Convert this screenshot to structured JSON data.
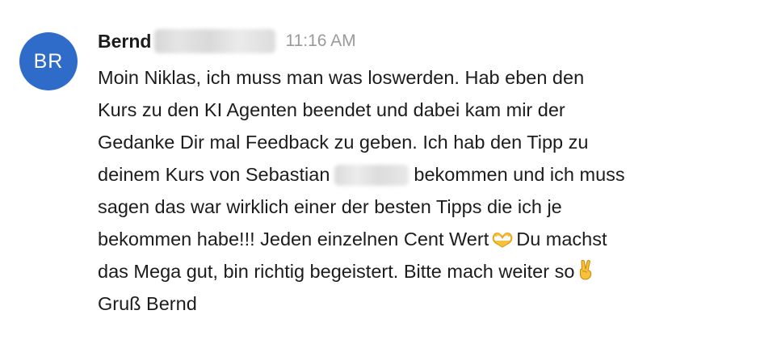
{
  "message": {
    "avatar_initials": "BR",
    "avatar_color": "#2f6bc9",
    "sender_first_name": "Bernd",
    "sender_last_name_redacted": true,
    "timestamp": "11:16 AM",
    "lines": {
      "l1": "Moin Niklas, ich muss man was loswerden. Hab eben den",
      "l2": "Kurs zu den KI Agenten beendet und dabei kam mir der",
      "l3": "Gedanke Dir mal Feedback zu geben. Ich hab den Tipp zu",
      "l4a": "deinem Kurs von Sebastian",
      "l4b": "bekommen und ich muss",
      "l5": "sagen das war wirklich einer der besten Tipps die ich je",
      "l6a": "bekommen habe!!! Jeden einzelnen Cent Wert",
      "l6b": "Du machst",
      "l7": "das Mega gut, bin richtig begeistert. Bitte mach weiter so",
      "l8": "Gruß Bernd"
    },
    "emojis": [
      "heart-hands-emoji",
      "victory-hand-emoji"
    ],
    "colors": {
      "text": "#1d1c1d",
      "timestamp": "#9a9a9a",
      "emoji_yellow": "#f7c23a"
    }
  }
}
